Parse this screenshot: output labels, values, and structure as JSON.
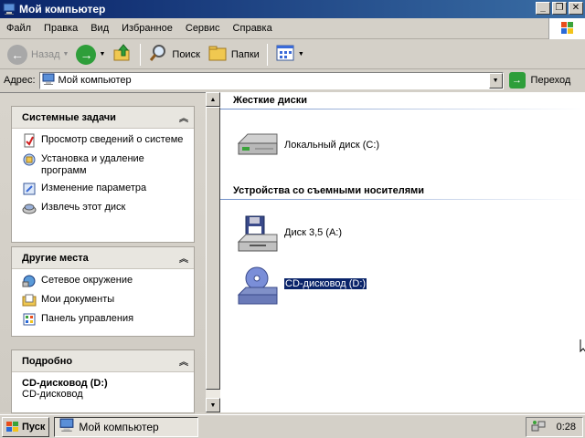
{
  "window": {
    "title": "Мой компьютер",
    "controls": [
      "minimize",
      "restore",
      "close"
    ]
  },
  "menu": {
    "items": [
      "Файл",
      "Правка",
      "Вид",
      "Избранное",
      "Сервис",
      "Справка"
    ]
  },
  "toolbar": {
    "back_label": "Назад",
    "search_label": "Поиск",
    "folders_label": "Папки"
  },
  "address": {
    "label": "Адрес:",
    "value": "Мой компьютер",
    "go_label": "Переход"
  },
  "tasks_pane": {
    "system": {
      "title": "Системные задачи",
      "items": [
        {
          "label": "Просмотр сведений о системе",
          "icon": "system-info-icon"
        },
        {
          "label": "Установка и удаление программ",
          "icon": "add-remove-programs-icon"
        },
        {
          "label": "Изменение параметра",
          "icon": "change-setting-icon"
        },
        {
          "label": "Извлечь этот диск",
          "icon": "eject-disc-icon"
        }
      ]
    },
    "other_places": {
      "title": "Другие места",
      "items": [
        {
          "label": "Сетевое окружение",
          "icon": "network-icon"
        },
        {
          "label": "Мои документы",
          "icon": "my-documents-icon"
        },
        {
          "label": "Панель управления",
          "icon": "control-panel-icon"
        }
      ]
    },
    "details": {
      "title": "Подробно",
      "name": "CD-дисковод (D:)",
      "type": "CD-дисковод"
    }
  },
  "content": {
    "hard_disks_title": "Жесткие диски",
    "removable_title": "Устройства со съемными носителями",
    "drives": {
      "local_c": "Локальный диск (C:)",
      "floppy_a": "Диск 3,5 (A:)",
      "cd_d": "CD-дисковод (D:)"
    },
    "selected": "CD-дисковод (D:)"
  },
  "taskbar": {
    "start_label": "Пуск",
    "window_label": "Мой компьютер",
    "clock": "0:28"
  },
  "colors": {
    "titlebar": "#0a246a",
    "selection": "#0a246a",
    "face": "#d4d0c8"
  }
}
